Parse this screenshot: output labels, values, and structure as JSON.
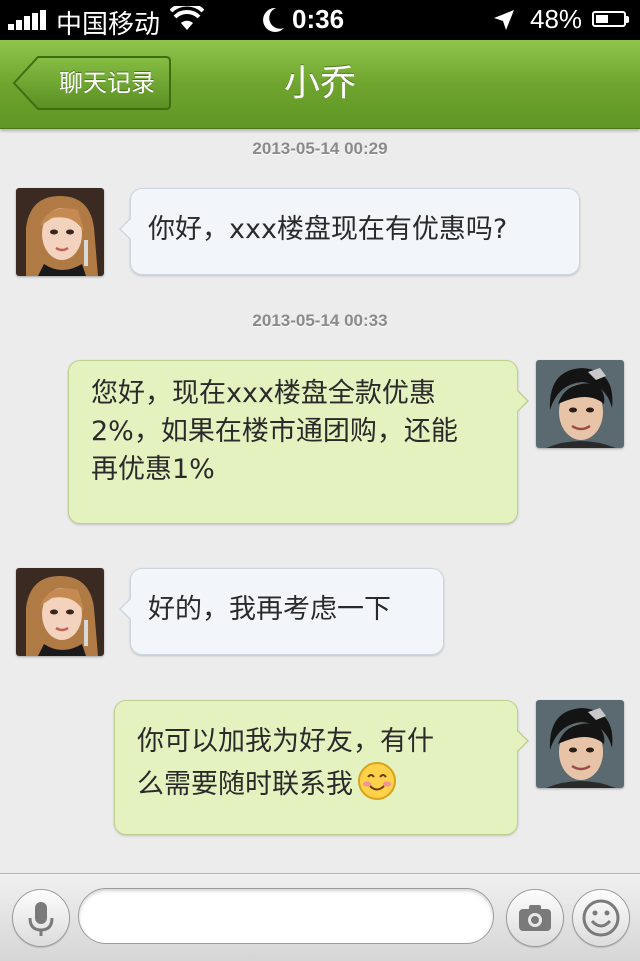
{
  "status_bar": {
    "carrier": "中国移动",
    "time": "0:36",
    "battery_percent": "48%",
    "battery_level": 0.48,
    "icons": [
      "signal-icon",
      "wifi-icon",
      "moon-icon",
      "location-icon",
      "battery-icon"
    ]
  },
  "nav": {
    "back_label": "聊天记录",
    "title": "小乔"
  },
  "messages": [
    {
      "timestamp": "2013-05-14 00:29"
    },
    {
      "side": "in",
      "lines": [
        "你好，xxx楼盘现在有优惠吗?"
      ]
    },
    {
      "timestamp": "2013-05-14 00:33"
    },
    {
      "side": "out",
      "lines": [
        "您好，现在xxx楼盘全款优惠",
        "2%，如果在楼市通团购，还能",
        "再优惠1%"
      ]
    },
    {
      "side": "in",
      "lines": [
        "好的，我再考虑一下"
      ]
    },
    {
      "side": "out",
      "lines": [
        "你可以加我为好友，有什",
        "么需要随时联系我"
      ],
      "emoji": "smile-emoji-icon"
    }
  ],
  "input": {
    "placeholder": "",
    "value": "",
    "icons": [
      "microphone-icon",
      "camera-icon",
      "smiley-icon"
    ]
  },
  "colors": {
    "nav_green": "#6fa52e",
    "incoming_bubble": "#f2f6fb",
    "outgoing_bubble": "#e4f2c0",
    "background": "#ececec"
  }
}
